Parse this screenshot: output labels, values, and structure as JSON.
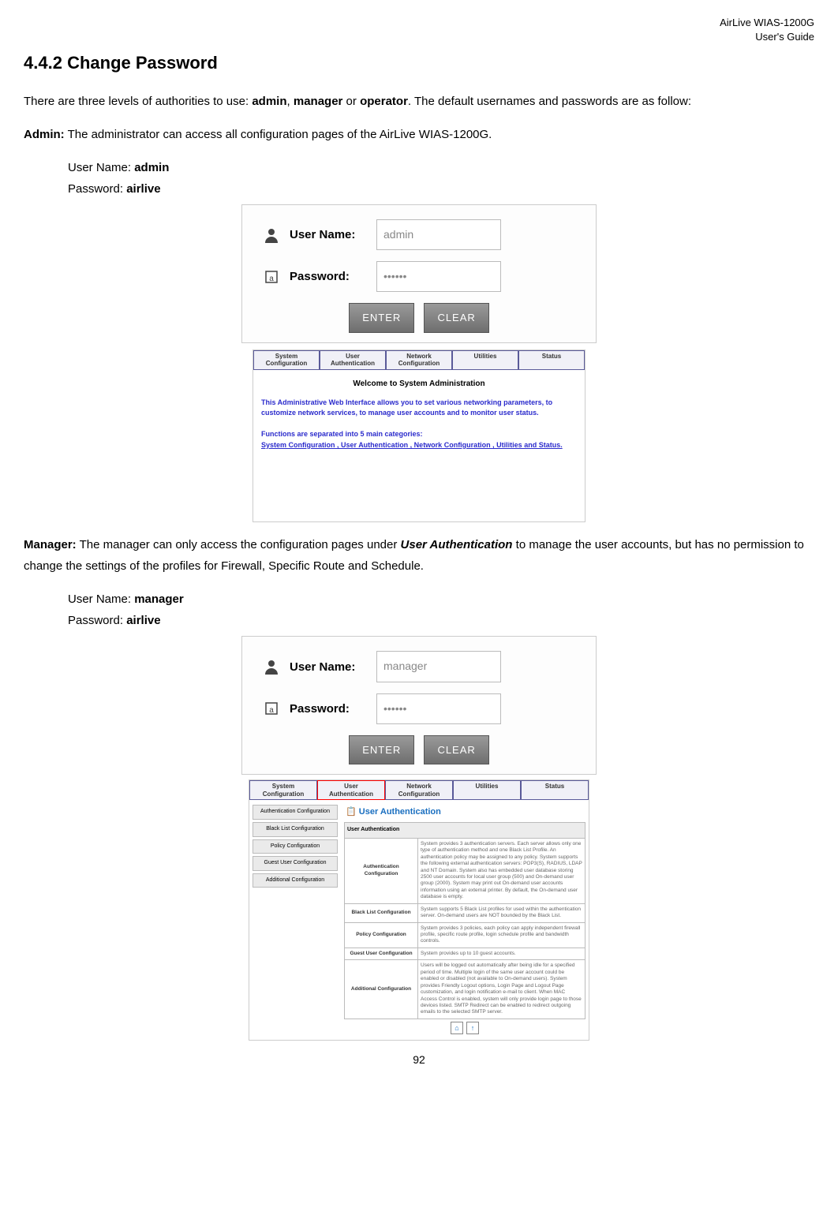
{
  "header": {
    "product": "AirLive WIAS-1200G",
    "guide": "User's Guide"
  },
  "section": {
    "number": "4.4.2",
    "title": "Change Password"
  },
  "intro": {
    "p1a": "There are three levels of authorities to use: ",
    "b1": "admin",
    "p1b": ", ",
    "b2": "manager",
    "p1c": " or ",
    "b3": "operator",
    "p1d": ". The default usernames and passwords are as follow:"
  },
  "admin": {
    "label": "Admin:",
    "desc": " The administrator can access all configuration pages of the AirLive WIAS-1200G.",
    "un_label": "User Name: ",
    "un_value": "admin",
    "pw_label": "Password: ",
    "pw_value": "airlive"
  },
  "login1": {
    "un_label": "User Name:",
    "un_value": "admin",
    "pw_label": "Password:",
    "pw_value": "••••••",
    "btn_enter": "ENTER",
    "btn_clear": "CLEAR"
  },
  "tabs1": {
    "t1a": "System",
    "t1b": "Configuration",
    "t2a": "User",
    "t2b": "Authentication",
    "t3a": "Network",
    "t3b": "Configuration",
    "t4": "Utilities",
    "t5": "Status"
  },
  "panel1": {
    "welcome": "Welcome to System Administration",
    "line1": "This Administrative Web Interface allows you to set various networking parameters, to customize network services, to manage user accounts and to monitor user status.",
    "line2": "Functions are separated into 5 main categories:",
    "links": "System Configuration , User Authentication , Network Configuration , Utilities and Status."
  },
  "manager": {
    "label": "Manager:",
    "desc1": " The manager can only access the configuration pages under ",
    "desc_bold": "User Authentication",
    "desc2": " to manage the user accounts, but has no permission to change the settings of the profiles for Firewall, Specific Route and Schedule.",
    "un_label": "User Name: ",
    "un_value": "manager",
    "pw_label": "Password: ",
    "pw_value": "airlive"
  },
  "login2": {
    "un_label": "User Name:",
    "un_value": "manager",
    "pw_label": "Password:",
    "pw_value": "••••••",
    "btn_enter": "ENTER",
    "btn_clear": "CLEAR"
  },
  "ua": {
    "title": "User Authentication",
    "table_header": "User Authentication",
    "side": {
      "s1": "Authentication Configuration",
      "s2": "Black List Configuration",
      "s3": "Policy Configuration",
      "s4": "Guest User Configuration",
      "s5": "Additional Configuration"
    },
    "rows": {
      "r1_label": "Authentication Configuration",
      "r1_text": "System provides 3 authentication servers. Each server allows only one type of authentication method and one Black List Profile. An authentication policy may be assigned to any policy. System supports the following external authentication servers: POP3(S), RADIUS, LDAP and NT Domain. System also has embedded user database storing 2500 user accounts for local user group (500) and On-demand user group (2000). System may print out On-demand user accounts information using an external printer. By default, the On-demand user database is empty.",
      "r2_label": "Black List Configuration",
      "r2_text": "System supports 5 Black List profiles for used within the authentication server. On-demand users are NOT bounded by the Black List.",
      "r3_label": "Policy Configuration",
      "r3_text": "System provides 3 policies, each policy can apply independent firewall profile, specific route profile, login schedule profile and bandwidth controls.",
      "r4_label": "Guest User Configuration",
      "r4_text": "System provides up to 10 guest accounts.",
      "r5_label": "Additional Configuration",
      "r5_text": "Users will be logged out automatically after being idle for a specified period of time. Multiple login of the same user account could be enabled or disabled (not available to On-demand users). System provides Friendly Logout options, Login Page and Logout Page customization, and login notification e-mail to client. When MAC Access Control is enabled, system will only provide login page to those devices listed. SMTP Redirect can be enabled to redirect outgoing emails to the selected SMTP server."
    }
  },
  "page_number": "92"
}
